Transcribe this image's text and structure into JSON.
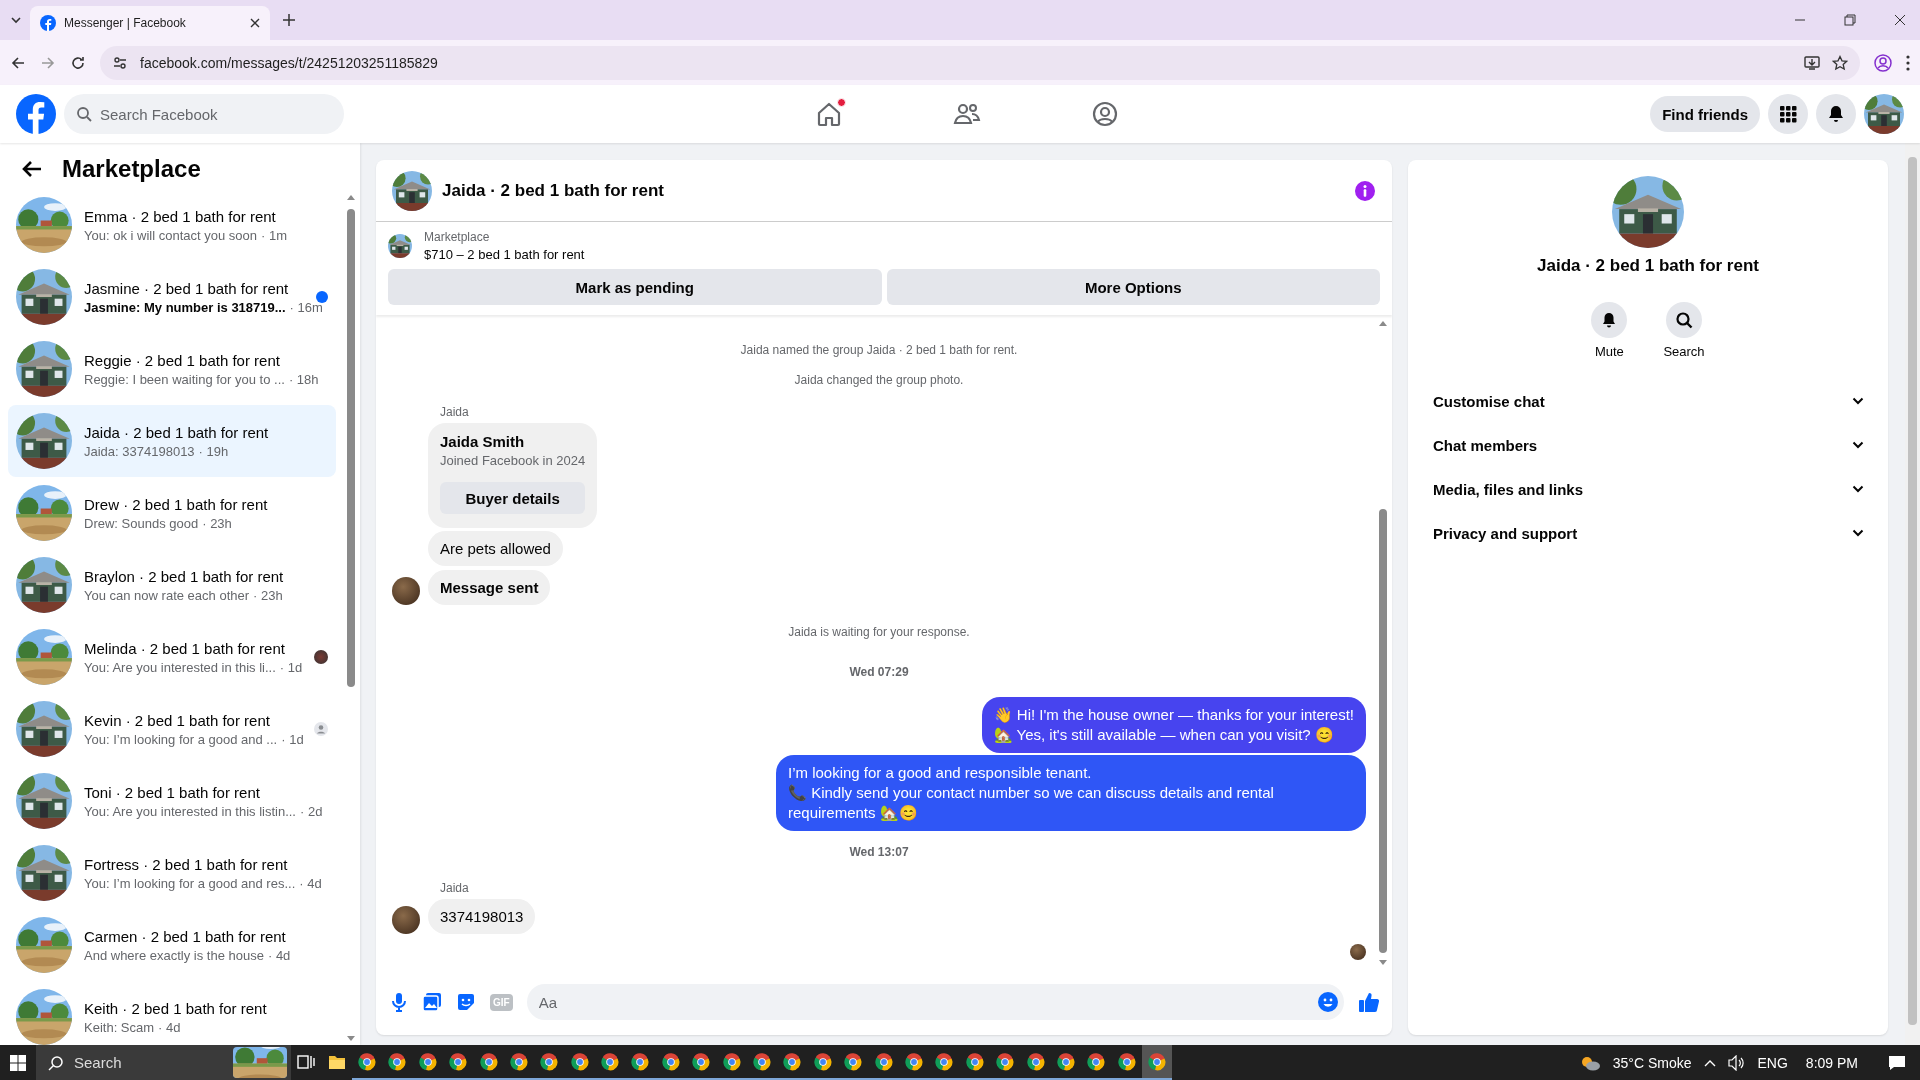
{
  "browser": {
    "tabs": [
      {
        "title": "Messenger | Facebook",
        "selected": true
      }
    ],
    "url": "facebook.com/messages/t/24251203251185829"
  },
  "topbar": {
    "search_placeholder": "Search Facebook",
    "nav": [
      {
        "kind": "home",
        "notification": true
      },
      {
        "kind": "friends",
        "notification": false
      },
      {
        "kind": "profile",
        "notification": false
      }
    ],
    "find_friends": "Find friends"
  },
  "sidebar": {
    "title": "Marketplace",
    "conversations": [
      {
        "title": "Emma · 2 bed 1 bath for rent",
        "preview": "You: ok i will contact you soon",
        "time": "· 1m",
        "unread": false,
        "selected": false
      },
      {
        "title": "Jasmine · 2 bed 1 bath for rent",
        "preview": "Jasmine: My number is 318719...",
        "time": "· 16m",
        "unread": true,
        "selected": false
      },
      {
        "title": "Reggie · 2 bed 1 bath for rent",
        "preview": "Reggie: I been waiting for you to ...",
        "time": "· 18h",
        "unread": false,
        "selected": false
      },
      {
        "title": "Jaida · 2 bed 1 bath for rent",
        "preview": "Jaida: 3374198013",
        "time": "· 19h",
        "unread": false,
        "selected": true
      },
      {
        "title": "Drew · 2 bed 1 bath for rent",
        "preview": "Drew: Sounds good",
        "time": "· 23h",
        "unread": false,
        "selected": false
      },
      {
        "title": "Braylon · 2 bed 1 bath for rent",
        "preview": "You can now rate each other",
        "time": "· 23h",
        "unread": false,
        "selected": false
      },
      {
        "title": "Melinda · 2 bed 1 bath for rent",
        "preview": "You: Are you interested in this li...",
        "time": "· 1d",
        "unread": false,
        "selected": false,
        "kind": "seen"
      },
      {
        "title": "Kevin · 2 bed 1 bath for rent",
        "preview": "You: I’m looking for a good and ...",
        "time": "· 1d",
        "unread": false,
        "selected": false,
        "kind": "delivered"
      },
      {
        "title": "Toni · 2 bed 1 bath for rent",
        "preview": "You: Are you interested in this listin...",
        "time": "· 2d",
        "unread": false,
        "selected": false
      },
      {
        "title": "Fortress · 2 bed 1 bath for rent",
        "preview": "You: I’m looking for a good and res...",
        "time": "· 4d",
        "unread": false,
        "selected": false
      },
      {
        "title": "Carmen · 2 bed 1 bath for rent",
        "preview": "And where exactly is the house",
        "time": "· 4d",
        "unread": false,
        "selected": false
      },
      {
        "title": "Keith · 2 bed 1 bath for rent",
        "preview": "Keith: Scam",
        "time": "· 4d",
        "unread": false,
        "selected": false
      }
    ]
  },
  "chat": {
    "title": "Jaida · 2 bed 1 bath for rent",
    "listing": {
      "source": "Marketplace",
      "summary": "$710 – 2 bed 1 bath for rent",
      "actions": [
        "Mark as pending",
        "More Options"
      ]
    },
    "messages": [
      {
        "kind": "event",
        "text": "Jaida named the group Jaida · 2 bed 1 bath for rent."
      },
      {
        "kind": "event",
        "text": "Jaida changed the group photo."
      },
      {
        "kind": "sender",
        "text": "Jaida"
      },
      {
        "kind": "card",
        "name": "Jaida Smith",
        "subtitle": "Joined Facebook in 2024",
        "button": "Buyer details"
      },
      {
        "kind": "incoming",
        "text": "Are pets allowed",
        "avatar": false,
        "bold": false
      },
      {
        "kind": "incoming",
        "text": "Message sent",
        "avatar": true,
        "bold": true
      },
      {
        "kind": "event",
        "text": "Jaida is waiting for your response."
      },
      {
        "kind": "timestamp",
        "text": "Wed 07:29"
      },
      {
        "kind": "outgoing",
        "lines": [
          "👋 Hi! I'm the house owner — thanks for your interest!",
          "🏡 Yes, it's still available — when can you visit? 😊"
        ]
      },
      {
        "kind": "outgoing",
        "lines": [
          "I’m looking for a good and responsible tenant.",
          "📞 Kindly send your contact number so we can discuss details and rental requirements 🏡😊"
        ]
      },
      {
        "kind": "timestamp",
        "text": "Wed 13:07"
      },
      {
        "kind": "sender",
        "text": "Jaida"
      },
      {
        "kind": "incoming",
        "text": "3374198013",
        "avatar": true,
        "bold": false
      },
      {
        "kind": "seen"
      }
    ],
    "composer": {
      "gif_label": "GIF",
      "placeholder": "Aa"
    }
  },
  "info_panel": {
    "title": "Jaida · 2 bed 1 bath for rent",
    "actions": [
      {
        "kind": "mute",
        "label": "Mute"
      },
      {
        "kind": "search",
        "label": "Search"
      }
    ],
    "sections": [
      {
        "label": "Customise chat",
        "expanded": false
      },
      {
        "label": "Chat members",
        "expanded": false
      },
      {
        "label": "Media, files and links",
        "expanded": false
      },
      {
        "label": "Privacy and support",
        "expanded": false
      }
    ]
  },
  "taskbar": {
    "search_placeholder": "Search",
    "apps": [
      {
        "kind": "task-view",
        "active": false
      },
      {
        "kind": "explorer",
        "active": false
      },
      {
        "kind": "chrome",
        "active": false
      },
      {
        "kind": "chrome",
        "active": false
      },
      {
        "kind": "chrome",
        "active": false
      },
      {
        "kind": "chrome",
        "active": false
      },
      {
        "kind": "chrome",
        "active": false
      },
      {
        "kind": "chrome",
        "active": false
      },
      {
        "kind": "chrome",
        "active": false
      },
      {
        "kind": "chrome",
        "active": false
      },
      {
        "kind": "chrome",
        "active": false
      },
      {
        "kind": "chrome",
        "active": false
      },
      {
        "kind": "chrome",
        "active": false
      },
      {
        "kind": "chrome",
        "active": false
      },
      {
        "kind": "chrome",
        "active": false
      },
      {
        "kind": "chrome",
        "active": false
      },
      {
        "kind": "chrome",
        "active": false
      },
      {
        "kind": "chrome",
        "active": false
      },
      {
        "kind": "chrome",
        "active": false
      },
      {
        "kind": "chrome",
        "active": false
      },
      {
        "kind": "chrome",
        "active": false
      },
      {
        "kind": "chrome",
        "active": false
      },
      {
        "kind": "chrome",
        "active": false
      },
      {
        "kind": "chrome",
        "active": false
      },
      {
        "kind": "chrome",
        "active": false
      },
      {
        "kind": "chrome",
        "active": false
      },
      {
        "kind": "chrome",
        "active": false
      },
      {
        "kind": "chrome",
        "active": false
      },
      {
        "kind": "chrome",
        "active": true
      }
    ],
    "weather": "35°C Smoke",
    "language": "ENG",
    "time": "8:09 PM"
  }
}
